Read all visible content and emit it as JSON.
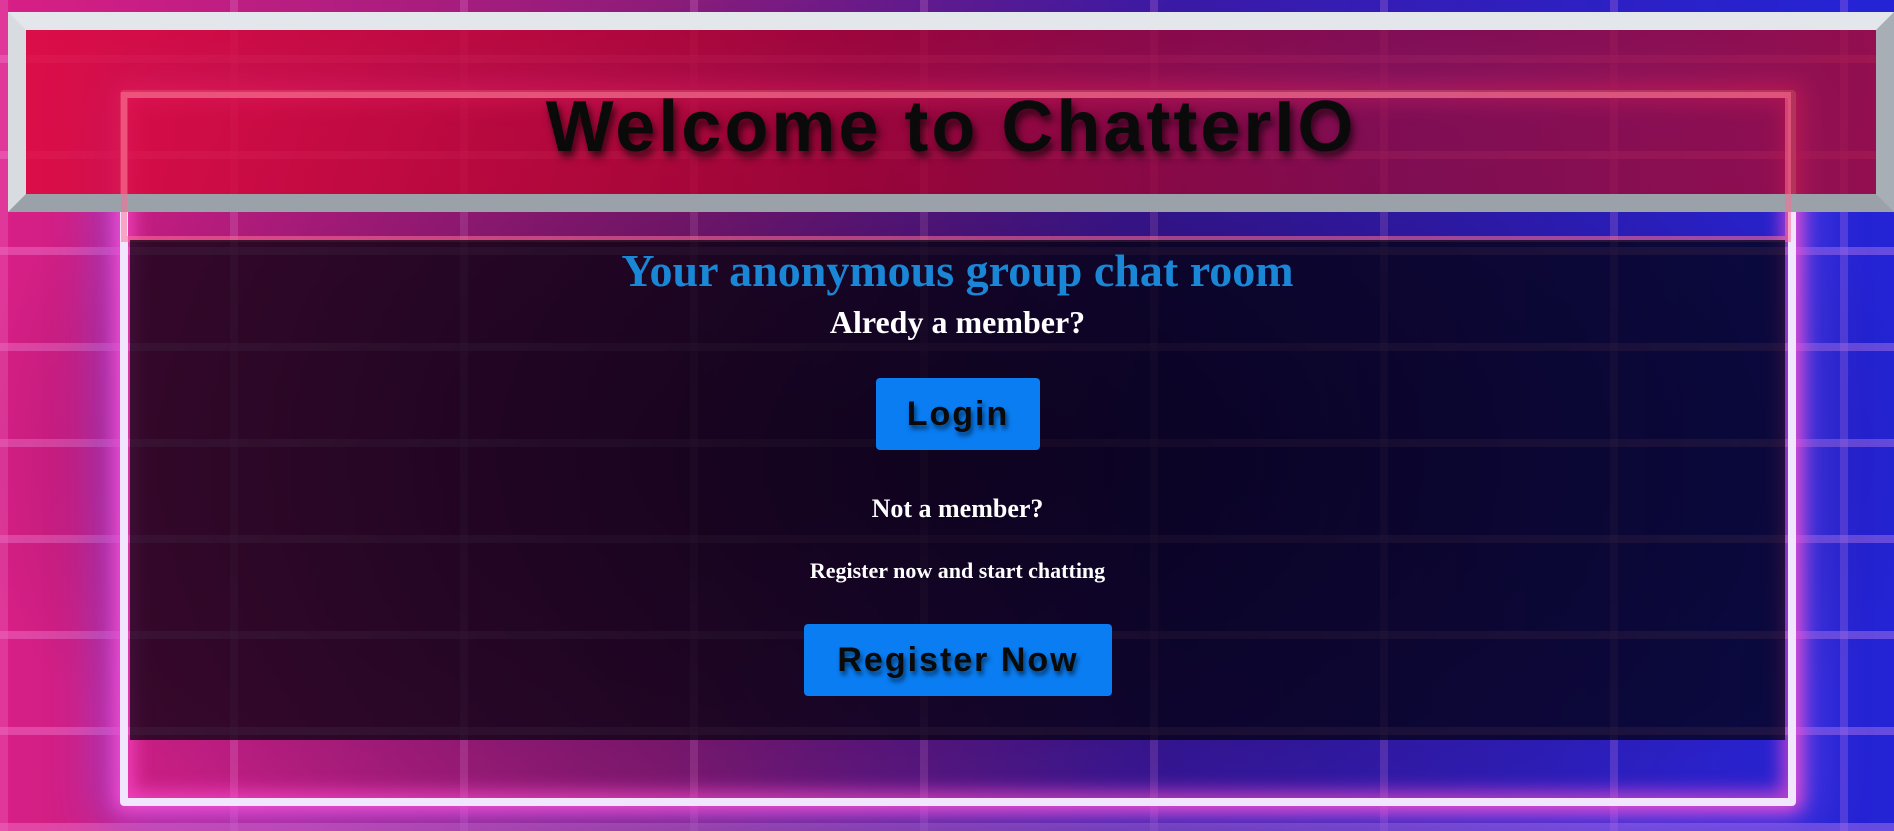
{
  "header": {
    "title": "Welcome to ChatterIO"
  },
  "main": {
    "subtitle": "Your anonymous group chat room",
    "already_member": "Alredy a member?",
    "login_label": "Login",
    "not_member": "Not a member?",
    "register_prompt": "Register now and start chatting",
    "register_label": "Register Now"
  },
  "colors": {
    "accent_blue": "#0a7df2",
    "subtitle_blue": "#1a86d6",
    "banner_red": "#b0002a",
    "neon_pink": "#ff50d2",
    "neon_blue": "#2424d6"
  }
}
